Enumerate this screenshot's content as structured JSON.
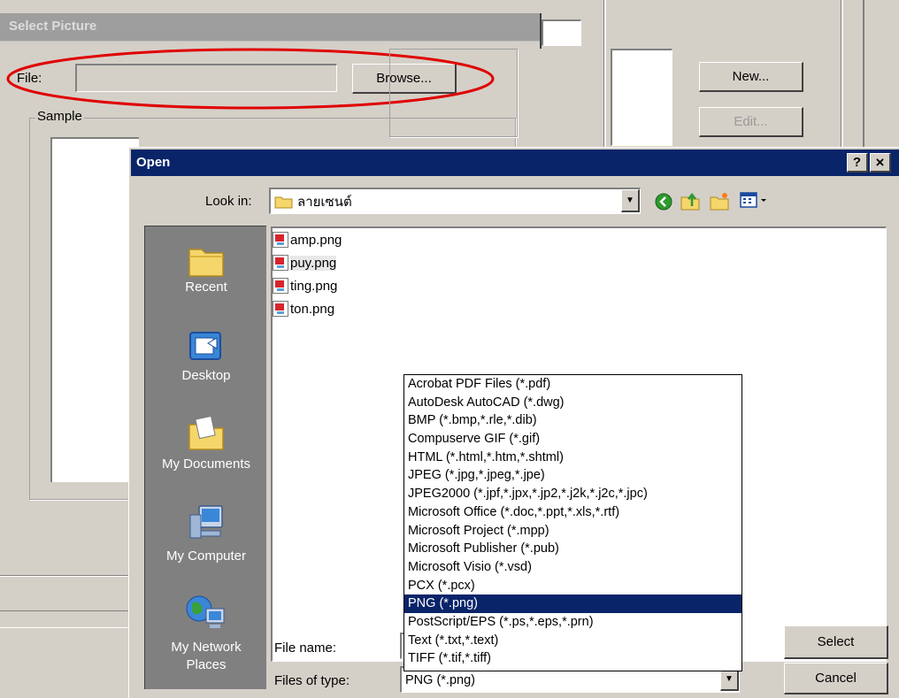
{
  "select_dialog": {
    "title": "Select Picture",
    "file_label": "File:",
    "file_value": "",
    "browse_label": "Browse...",
    "sample_label": "Sample"
  },
  "side_buttons": {
    "new_label": "New...",
    "edit_label": "Edit..."
  },
  "open_dialog": {
    "title": "Open",
    "help_label": "?",
    "close_label": "×",
    "look_in_label": "Look in:",
    "look_in_value": "ลายเซนต์",
    "places": [
      "Recent",
      "Desktop",
      "My Documents",
      "My Computer",
      "My Network Places"
    ],
    "files": [
      "amp.png",
      "puy.png",
      "ting.png",
      "ton.png"
    ],
    "selected_file_index": 1,
    "file_name_label": "File name:",
    "file_name_value": "",
    "files_of_type_label": "Files of type:",
    "files_of_type_value": "PNG (*.png)",
    "file_types": [
      "Acrobat PDF Files (*.pdf)",
      "AutoDesk AutoCAD (*.dwg)",
      "BMP (*.bmp,*.rle,*.dib)",
      "Compuserve GIF (*.gif)",
      "HTML (*.html,*.htm,*.shtml)",
      "JPEG (*.jpg,*.jpeg,*.jpe)",
      "JPEG2000 (*.jpf,*.jpx,*.jp2,*.j2k,*.j2c,*.jpc)",
      "Microsoft Office (*.doc,*.ppt,*.xls,*.rtf)",
      "Microsoft Project (*.mpp)",
      "Microsoft Publisher (*.pub)",
      "Microsoft Visio (*.vsd)",
      "PCX (*.pcx)",
      "PNG (*.png)",
      "PostScript/EPS (*.ps,*.eps,*.prn)",
      "Text (*.txt,*.text)",
      "TIFF (*.tif,*.tiff)"
    ],
    "selected_type_index": 12,
    "select_label": "Select",
    "cancel_label": "Cancel"
  },
  "colors": {
    "dialog_bg": "#d4d0c8",
    "title_active": "#0a246a",
    "title_inactive": "#9e9e9e",
    "highlight": "#0a246a",
    "annotation_ellipse": "#e00000",
    "places_bg": "#808080"
  }
}
